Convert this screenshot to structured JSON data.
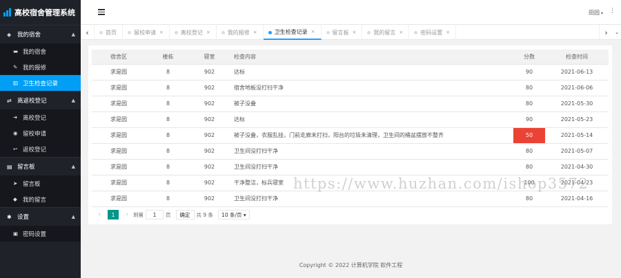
{
  "app": {
    "title": "高校宿舍管理系统"
  },
  "sidebar": {
    "groups": [
      {
        "title": "我的宿舍",
        "icon": "cube-icon",
        "arrow": "▲",
        "items": [
          {
            "label": "我的宿舍",
            "icon": "bed-icon"
          },
          {
            "label": "我的报修",
            "icon": "wrench-icon"
          },
          {
            "label": "卫生检查记录",
            "icon": "chart-icon",
            "active": true
          }
        ]
      },
      {
        "title": "离返校登记",
        "icon": "exchange-icon",
        "arrow": "▲",
        "items": [
          {
            "label": "离校登记",
            "icon": "sign-out-icon"
          },
          {
            "label": "留校申请",
            "icon": "globe-icon"
          },
          {
            "label": "返校登记",
            "icon": "reply-icon"
          }
        ]
      },
      {
        "title": "留言板",
        "icon": "message-icon",
        "arrow": "▲",
        "items": [
          {
            "label": "留言板",
            "icon": "send-icon"
          },
          {
            "label": "我的留言",
            "icon": "tags-icon"
          }
        ]
      },
      {
        "title": "设置",
        "icon": "gear-icon",
        "arrow": "▲",
        "items": [
          {
            "label": "密码设置",
            "icon": "lock-icon"
          }
        ]
      }
    ]
  },
  "header": {
    "user": "田园",
    "caret": "▾",
    "more": "⋮",
    "menu_icon": "menu-icon"
  },
  "tabs": {
    "prev": "‹",
    "next": "›",
    "dropdown": "⌄",
    "items": [
      {
        "label": "首页",
        "close": ""
      },
      {
        "label": "留校申请",
        "close": "×"
      },
      {
        "label": "离校登记",
        "close": "×"
      },
      {
        "label": "我的报修",
        "close": "×"
      },
      {
        "label": "卫生检查记录",
        "close": "×",
        "active": true
      },
      {
        "label": "留言板",
        "close": "×"
      },
      {
        "label": "我的留言",
        "close": "×"
      },
      {
        "label": "密码设置",
        "close": "×"
      }
    ]
  },
  "table": {
    "headers": [
      "宿舍区",
      "楼栋",
      "寝室",
      "检查内容",
      "分数",
      "检查时间"
    ],
    "rows": [
      [
        "求是园",
        "8",
        "902",
        "达标",
        "90",
        "2021-06-13"
      ],
      [
        "求是园",
        "8",
        "902",
        "宿舍地板没打扫干净",
        "80",
        "2021-06-06"
      ],
      [
        "求是园",
        "8",
        "902",
        "被子没叠",
        "80",
        "2021-05-30"
      ],
      [
        "求是园",
        "8",
        "902",
        "达标",
        "90",
        "2021-05-23"
      ],
      [
        "求是园",
        "8",
        "902",
        "被子没叠，衣服乱挂，门前走廊未打扫，阳台的垃圾未清理，卫生间的桶盆摆放不整齐",
        "50",
        "2021-05-14"
      ],
      [
        "求是园",
        "8",
        "902",
        "卫生间没打扫干净",
        "80",
        "2021-05-07"
      ],
      [
        "求是园",
        "8",
        "902",
        "卫生间没打扫干净",
        "80",
        "2021-04-30"
      ],
      [
        "求是园",
        "8",
        "902",
        "干净整洁，标兵寝室",
        "100",
        "2021-04-23"
      ],
      [
        "求是园",
        "8",
        "902",
        "卫生间没打扫干净",
        "80",
        "2021-04-16"
      ]
    ],
    "highlight_row": 4,
    "highlight_color": "#ea4335"
  },
  "pager": {
    "prev": "‹",
    "current": "1",
    "next": "›",
    "goto_label": "到第",
    "goto_value": "1",
    "page_unit": "页",
    "confirm": "确定",
    "total": "共 9 条",
    "page_size": "10 条/页",
    "page_size_caret": "▾"
  },
  "footer": {
    "text": "Copyright © 2022 计算机学院 软件工程"
  },
  "watermark": "https://www.huzhan.com/ishop3572",
  "colors": {
    "accent": "#009ef5",
    "sidebar_bg": "#20222a",
    "pager_active": "#009688"
  }
}
